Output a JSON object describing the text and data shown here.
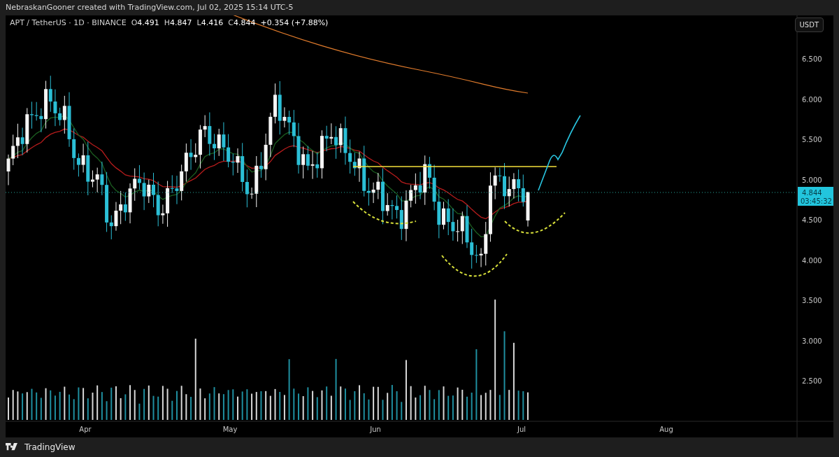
{
  "header": {
    "attribution": "NebraskanGooner created with TradingView.com, Jul 02, 2025 15:14 UTC-5"
  },
  "legend": {
    "symbol": "APT / TetherUS · 1D · BINANCE",
    "ohlc": [
      {
        "label": "O",
        "value": "4.491"
      },
      {
        "label": "H",
        "value": "4.847"
      },
      {
        "label": "L",
        "value": "4.416"
      },
      {
        "label": "C",
        "value": "4.844"
      }
    ],
    "change": "+0.354 (+7.88%)"
  },
  "currency_button": "USDT",
  "price_axis": [
    "6.500",
    "6.000",
    "5.500",
    "5.000",
    "4.500",
    "4.000",
    "3.500",
    "3.000",
    "2.500"
  ],
  "current_price": {
    "price": "4.844",
    "countdown": "03:45:32"
  },
  "time_axis": [
    "Apr",
    "May",
    "Jun",
    "Jul",
    "Aug"
  ],
  "footer": {
    "brand": "TradingView"
  }
}
